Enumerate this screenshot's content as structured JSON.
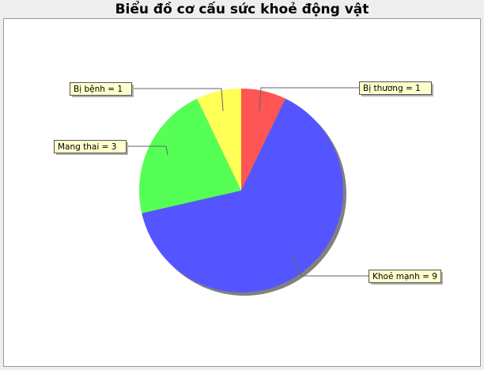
{
  "chart_data": {
    "type": "pie",
    "title": "Biểu đồ cơ cấu sức khoẻ động vật",
    "slices": [
      {
        "label": "Bị thương",
        "value": 1,
        "color": "#ff5555",
        "label_text": "Bị thương = 1",
        "label_side": "right"
      },
      {
        "label": "Khoẻ mạnh",
        "value": 9,
        "color": "#5555ff",
        "label_text": "Khoẻ mạnh = 9",
        "label_side": "right"
      },
      {
        "label": "Mang thai",
        "value": 3,
        "color": "#55ff55",
        "label_text": "Mang thai = 3",
        "label_side": "left"
      },
      {
        "label": "Bị bệnh",
        "value": 1,
        "color": "#ffff55",
        "label_text": "Bị bệnh = 1",
        "label_side": "left"
      }
    ],
    "background": "#eeeeee",
    "plot_background": "#ffffff",
    "label_box_color": "#ffffcc"
  }
}
